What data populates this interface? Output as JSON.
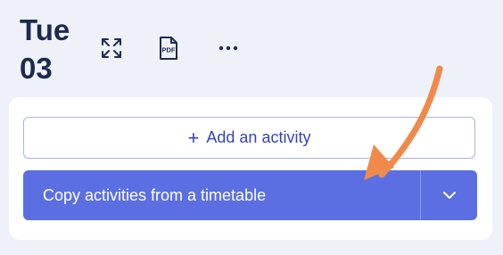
{
  "header": {
    "day_name": "Tue",
    "day_number": "03",
    "icons": [
      "expand-icon",
      "pdf-icon",
      "more-icon"
    ],
    "pdf_icon_text": "PDF"
  },
  "actions": {
    "add_activity_icon": "+",
    "add_activity_label": "Add an activity",
    "copy_label": "Copy activities from a timetable",
    "copy_dropdown_icon": "chevron-down-icon"
  },
  "colors": {
    "background": "#eef1f8",
    "card": "#ffffff",
    "text_dark": "#1d2a4e",
    "primary": "#5b6fe2",
    "primary_text_outline": "#3544b9",
    "outline_border": "#aab1ea",
    "annotation_arrow": "#f08a4b"
  }
}
